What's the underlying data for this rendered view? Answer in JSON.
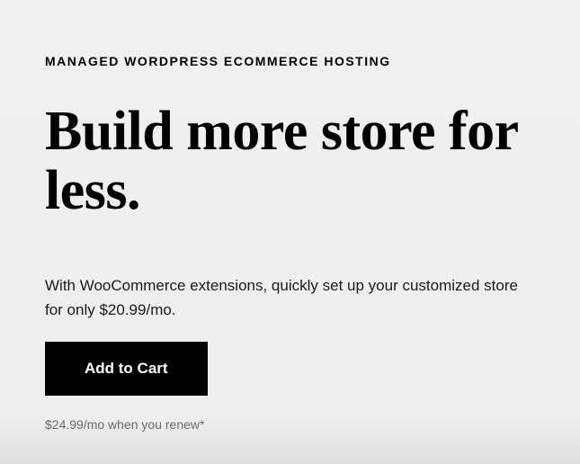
{
  "hero": {
    "eyebrow": "MANAGED WORDPRESS ECOMMERCE HOSTING",
    "headline": "Build more store for less.",
    "description": "With WooCommerce extensions, quickly set up your customized store for only $20.99/mo.",
    "cta_label": "Add to Cart",
    "renewal_note": "$24.99/mo when you renew*"
  }
}
